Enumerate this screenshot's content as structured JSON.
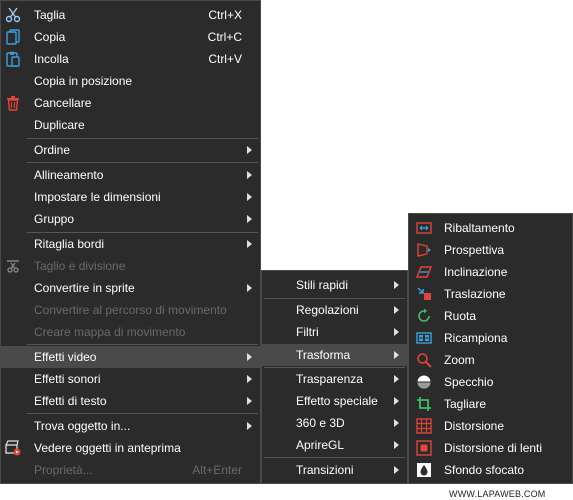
{
  "main_menu": {
    "cut": {
      "label": "Taglia",
      "shortcut": "Ctrl+X"
    },
    "copy": {
      "label": "Copia",
      "shortcut": "Ctrl+C"
    },
    "paste": {
      "label": "Incolla",
      "shortcut": "Ctrl+V"
    },
    "paste_in_place": {
      "label": "Copia in posizione"
    },
    "delete": {
      "label": "Cancellare"
    },
    "duplicate": {
      "label": "Duplicare"
    },
    "order": {
      "label": "Ordine"
    },
    "align": {
      "label": "Allineamento"
    },
    "set_size": {
      "label": "Impostare le dimensioni"
    },
    "group": {
      "label": "Gruppo"
    },
    "crop_borders": {
      "label": "Ritaglia bordi"
    },
    "cut_split": {
      "label": "Taglio e divisione"
    },
    "convert_sprite": {
      "label": "Convertire in sprite"
    },
    "convert_motion_path": {
      "label": "Convertire al percorso di movimento"
    },
    "create_motion_map": {
      "label": "Creare mappa di movimento"
    },
    "video_effects": {
      "label": "Effetti video"
    },
    "sound_effects": {
      "label": "Effetti sonori"
    },
    "text_effects": {
      "label": "Effetti di testo"
    },
    "find_object": {
      "label": "Trova oggetto in..."
    },
    "preview_objects": {
      "label": "Vedere oggetti in anteprima"
    },
    "properties": {
      "label": "Proprietà...",
      "shortcut": "Alt+Enter"
    }
  },
  "submenu_video_effects": {
    "quick_styles": "Stili rapidi",
    "adjustments": "Regolazioni",
    "filters": "Filtri",
    "transform": "Trasforma",
    "transparency": "Trasparenza",
    "special_effect": "Effetto speciale",
    "three_sixty_3d": "360 e 3D",
    "apprire_gl": "AprireGL",
    "transitions": "Transizioni"
  },
  "submenu_transform": {
    "flip": "Ribaltamento",
    "perspective": "Prospettiva",
    "skew": "Inclinazione",
    "translation": "Traslazione",
    "rotate": "Ruota",
    "resample": "Ricampiona",
    "zoom": "Zoom",
    "mirror": "Specchio",
    "crop": "Tagliare",
    "distortion": "Distorsione",
    "lens_distortion": "Distorsione di lenti",
    "blurred_background": "Sfondo sfocato"
  },
  "watermark": "WWW.LAPAWEB.COM",
  "colors": {
    "menu_bg": "#2b2b2b",
    "selected_bg": "#4a4a4a",
    "text": "#ffffff",
    "disabled_text": "#6a6a6a",
    "accent_red": "#e0443a",
    "accent_blue": "#3aa0e0",
    "accent_green": "#3fc060"
  }
}
